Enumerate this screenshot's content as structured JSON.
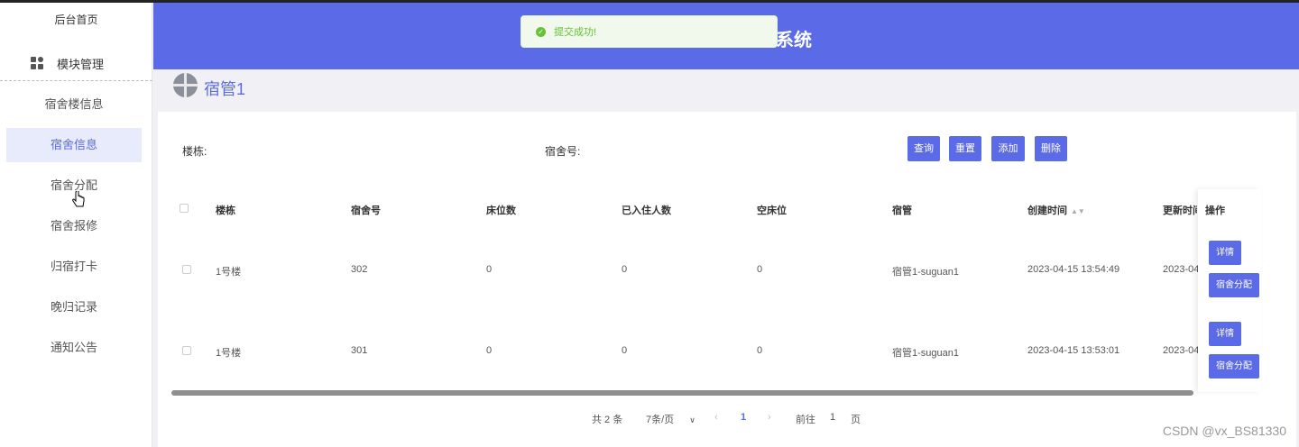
{
  "sidebar": {
    "home": "后台首页",
    "module": "模块管理",
    "items": [
      {
        "label": "宿舍楼信息",
        "active": false
      },
      {
        "label": "宿舍信息",
        "active": true
      },
      {
        "label": "宿舍分配",
        "active": false
      },
      {
        "label": "宿舍报修",
        "active": false
      },
      {
        "label": "归宿打卡",
        "active": false
      },
      {
        "label": "晚归记录",
        "active": false
      },
      {
        "label": "通知公告",
        "active": false
      }
    ]
  },
  "header": {
    "title_visible": "系统",
    "color": "#5b6ae6"
  },
  "toast": {
    "message": "提交成功!",
    "color": "#67c23a"
  },
  "user": {
    "name": "宿管1"
  },
  "search": {
    "building_label": "楼栋:",
    "room_label": "宿舍号:"
  },
  "toolbar": {
    "query": "查询",
    "reset": "重置",
    "add": "添加",
    "delete": "删除"
  },
  "table": {
    "columns": [
      "楼栋",
      "宿舍号",
      "床位数",
      "已入住人数",
      "空床位",
      "宿管",
      "创建时间",
      "更新时间",
      "操作"
    ],
    "rows": [
      {
        "building": "1号楼",
        "room": "302",
        "beds": "0",
        "occupied": "0",
        "empty": "0",
        "manager": "宿管1-suguan1",
        "created": "2023-04-15 13:54:49",
        "updated": "2023-04-"
      },
      {
        "building": "1号楼",
        "room": "301",
        "beds": "0",
        "occupied": "0",
        "empty": "0",
        "manager": "宿管1-suguan1",
        "created": "2023-04-15 13:53:01",
        "updated": "2023-04-"
      }
    ],
    "row_actions": {
      "detail": "详情",
      "assign": "宿舍分配"
    }
  },
  "pagination": {
    "total": "共 2 条",
    "page_size": "7条/页",
    "current": "1",
    "goto_label": "前往",
    "goto_value": "1",
    "page_suffix": "页"
  },
  "watermark": "CSDN @vx_BS81330"
}
